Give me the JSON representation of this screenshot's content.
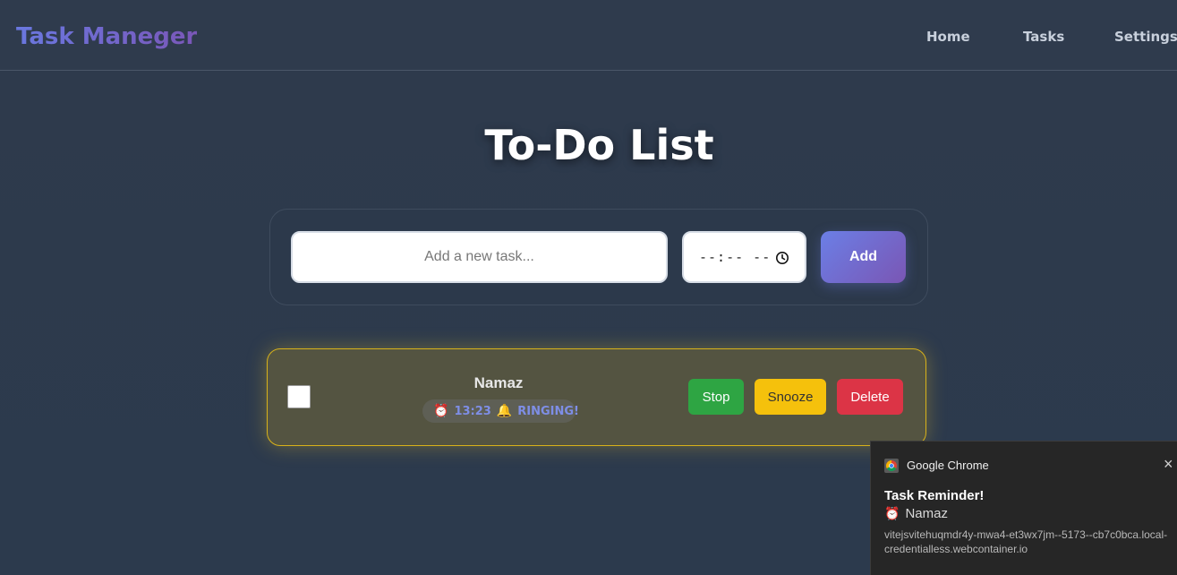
{
  "nav": {
    "brand": "Task Maneger",
    "links": [
      "Home",
      "Tasks",
      "Settings"
    ]
  },
  "page_title": "To-Do List",
  "form": {
    "task_placeholder": "Add a new task...",
    "time_value": "--:-- --",
    "add_label": "Add"
  },
  "tasks": [
    {
      "name": "Namaz",
      "alarm_emoji": "⏰",
      "time": "13:23",
      "bell_emoji": "🔔",
      "status": "RINGING!",
      "completed": false,
      "buttons": {
        "stop": "Stop",
        "snooze": "Snooze",
        "delete": "Delete"
      }
    }
  ],
  "notification": {
    "app": "Google Chrome",
    "title": "Task Reminder!",
    "body_emoji": "⏰",
    "body": "Namaz",
    "url": "vitejsvitehuqmdr4y-mwa4-et3wx7jm--5173--cb7c0bca.local-credentialless.webcontainer.io",
    "close": "×"
  },
  "colors": {
    "background": "#2e3a4c",
    "brand_gradient_start": "#6a78e0",
    "brand_gradient_end": "#7a57b8",
    "ringing_border": "#d8b21a",
    "stop": "#2ea543",
    "snooze": "#f5c10c",
    "delete": "#dc3446"
  },
  "icons": {
    "time_picker": "clock-icon",
    "notification_app": "chrome-icon",
    "notification_close": "close-icon"
  }
}
